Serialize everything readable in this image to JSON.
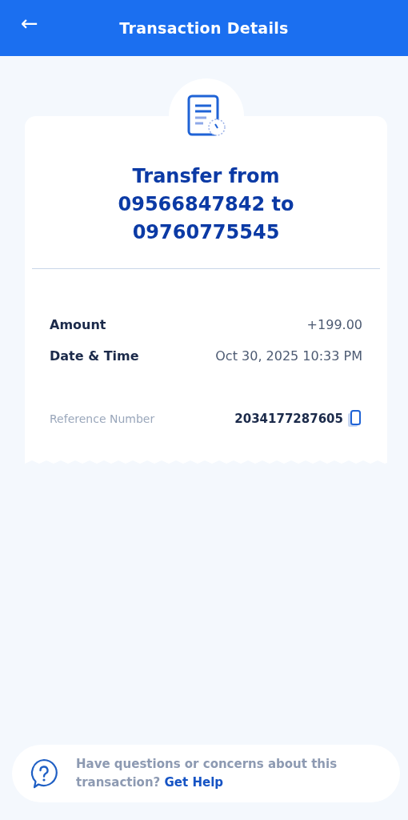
{
  "header": {
    "back_icon": "←",
    "title": "Transaction Details"
  },
  "receipt": {
    "title": "Transfer from 09566847842 to 09760775545",
    "details": [
      {
        "kind": "detail",
        "label": "Amount",
        "value": "+199.00"
      },
      {
        "kind": "detail",
        "label": "Date & Time",
        "value": "Oct 30, 2025 10:33 PM"
      },
      {
        "kind": "reference",
        "label": "Reference Number",
        "value": "2034177287605"
      }
    ]
  },
  "help": {
    "text": "Have questions or concerns about this transaction?",
    "link": "Get Help"
  }
}
